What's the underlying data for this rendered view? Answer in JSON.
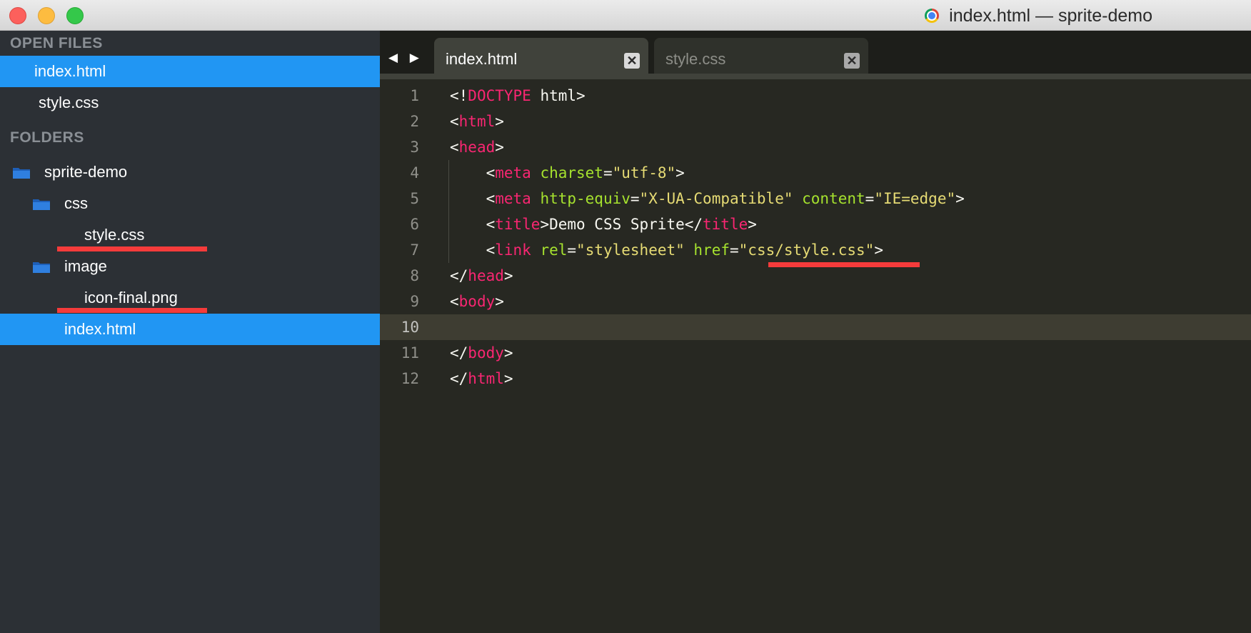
{
  "window": {
    "title": "index.html — sprite-demo"
  },
  "sidebar": {
    "open_files_title": "OPEN FILES",
    "open_files": [
      {
        "label": "index.html",
        "selected": true
      },
      {
        "label": "style.css",
        "selected": false
      }
    ],
    "folders_title": "FOLDERS",
    "tree": [
      {
        "label": "sprite-demo",
        "type": "folder",
        "depth": 0
      },
      {
        "label": "css",
        "type": "folder",
        "depth": 1
      },
      {
        "label": "style.css",
        "type": "file",
        "depth": 2,
        "underlined": true
      },
      {
        "label": "image",
        "type": "folder",
        "depth": 1
      },
      {
        "label": "icon-final.png",
        "type": "file",
        "depth": 2,
        "underlined": true
      },
      {
        "label": "index.html",
        "type": "file",
        "depth": 1,
        "selected": true
      }
    ]
  },
  "editor": {
    "nav_arrows": "◀ ▶",
    "tabs": [
      {
        "label": "index.html",
        "active": true,
        "close": "✕"
      },
      {
        "label": "style.css",
        "active": false,
        "close": "✕"
      }
    ],
    "current_line": 10,
    "lines": [
      {
        "n": "1",
        "tokens": [
          [
            "tx",
            "<!"
          ],
          [
            "tg",
            "DOCTYPE"
          ],
          [
            "tx",
            " html>"
          ]
        ]
      },
      {
        "n": "2",
        "tokens": [
          [
            "tx",
            "<"
          ],
          [
            "tg",
            "html"
          ],
          [
            "tx",
            ">"
          ]
        ]
      },
      {
        "n": "3",
        "tokens": [
          [
            "tx",
            "<"
          ],
          [
            "tg",
            "head"
          ],
          [
            "tx",
            ">"
          ]
        ]
      },
      {
        "n": "4",
        "tokens": [
          [
            "tx",
            "    <"
          ],
          [
            "tg",
            "meta"
          ],
          [
            "tx",
            " "
          ],
          [
            "at",
            "charset"
          ],
          [
            "tx",
            "="
          ],
          [
            "st",
            "\"utf-8\""
          ],
          [
            "tx",
            ">"
          ]
        ]
      },
      {
        "n": "5",
        "tokens": [
          [
            "tx",
            "    <"
          ],
          [
            "tg",
            "meta"
          ],
          [
            "tx",
            " "
          ],
          [
            "at",
            "http-equiv"
          ],
          [
            "tx",
            "="
          ],
          [
            "st",
            "\"X-UA-Compatible\""
          ],
          [
            "tx",
            " "
          ],
          [
            "at",
            "content"
          ],
          [
            "tx",
            "="
          ],
          [
            "st",
            "\"IE=edge\""
          ],
          [
            "tx",
            ">"
          ]
        ]
      },
      {
        "n": "6",
        "tokens": [
          [
            "tx",
            "    <"
          ],
          [
            "tg",
            "title"
          ],
          [
            "tx",
            ">Demo CSS Sprite</"
          ],
          [
            "tg",
            "title"
          ],
          [
            "tx",
            ">"
          ]
        ]
      },
      {
        "n": "7",
        "tokens": [
          [
            "tx",
            "    <"
          ],
          [
            "tg",
            "link"
          ],
          [
            "tx",
            " "
          ],
          [
            "at",
            "rel"
          ],
          [
            "tx",
            "="
          ],
          [
            "st",
            "\"stylesheet\""
          ],
          [
            "tx",
            " "
          ],
          [
            "at",
            "href"
          ],
          [
            "tx",
            "="
          ],
          [
            "st",
            "\"css/style.css\""
          ],
          [
            "tx",
            ">"
          ]
        ]
      },
      {
        "n": "8",
        "tokens": [
          [
            "tx",
            "</"
          ],
          [
            "tg",
            "head"
          ],
          [
            "tx",
            ">"
          ]
        ]
      },
      {
        "n": "9",
        "tokens": [
          [
            "tx",
            "<"
          ],
          [
            "tg",
            "body"
          ],
          [
            "tx",
            ">"
          ]
        ]
      },
      {
        "n": "10",
        "tokens": []
      },
      {
        "n": "11",
        "tokens": [
          [
            "tx",
            "</"
          ],
          [
            "tg",
            "body"
          ],
          [
            "tx",
            ">"
          ]
        ]
      },
      {
        "n": "12",
        "tokens": [
          [
            "tx",
            "</"
          ],
          [
            "tg",
            "html"
          ],
          [
            "tx",
            ">"
          ]
        ]
      }
    ]
  },
  "colors": {
    "selection": "#2196f3",
    "annotation_underline": "#f53b3b",
    "folder_icon": "#2f7fe0"
  },
  "icons": {
    "folder": "folder-icon",
    "close": "close-icon",
    "chrome": "chrome-icon"
  }
}
